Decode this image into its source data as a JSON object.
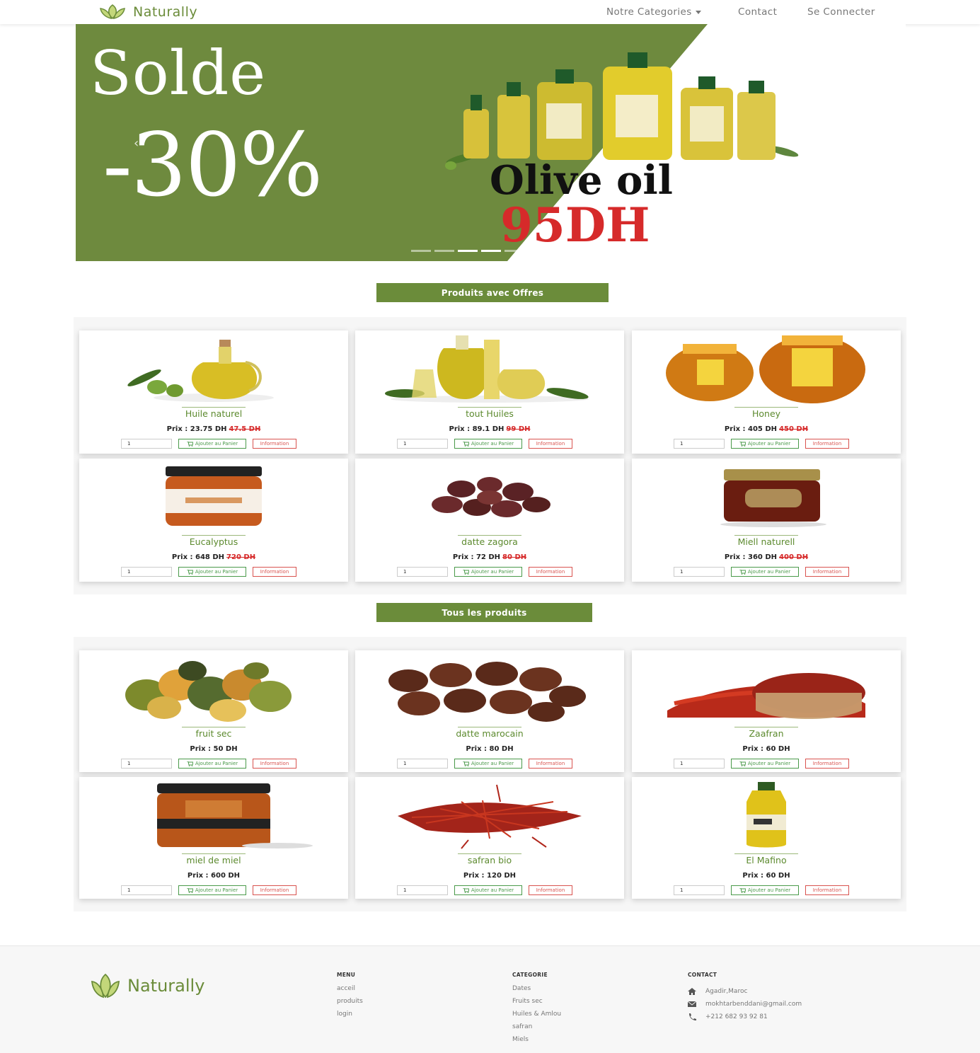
{
  "nav": {
    "brand": "Naturally",
    "categories": "Notre Categories",
    "contact": "Contact",
    "login": "Se Connecter"
  },
  "hero": {
    "line1": "Solde",
    "line2": "-30%",
    "product": "Olive oil",
    "price": "95DH",
    "prev": "‹",
    "active_slide": 3,
    "slide_count": 5
  },
  "colors": {
    "accent": "#6b8c3a",
    "danger": "#d62a2a"
  },
  "offers": {
    "title": "Produits avec Offres",
    "products": [
      {
        "name": "Huile naturel",
        "price": "Prix : 23.75 DH",
        "old": "47.5 DH",
        "qty": "1",
        "cart": "Ajouter au Panier",
        "info": "Information",
        "image": "olive-oil-jug"
      },
      {
        "name": "tout Huiles",
        "price": "Prix : 89.1 DH",
        "old": "99 DH",
        "qty": "1",
        "cart": "Ajouter au Panier",
        "info": "Information",
        "image": "oil-bottles"
      },
      {
        "name": "Honey",
        "price": "Prix : 405 DH",
        "old": "450 DH",
        "qty": "1",
        "cart": "Ajouter au Panier",
        "info": "Information",
        "image": "honey-jars"
      },
      {
        "name": "Eucalyptus",
        "price": "Prix : 648 DH",
        "old": "720 DH",
        "qty": "1",
        "cart": "Ajouter au Panier",
        "info": "Information",
        "image": "eucalyptus-jar"
      },
      {
        "name": "datte zagora",
        "price": "Prix : 72 DH",
        "old": "80 DH",
        "qty": "1",
        "cart": "Ajouter au Panier",
        "info": "Information",
        "image": "dates-small"
      },
      {
        "name": "Miell naturell",
        "price": "Prix : 360 DH",
        "old": "400 DH",
        "qty": "1",
        "cart": "Ajouter au Panier",
        "info": "Information",
        "image": "honey-dark-jar"
      }
    ]
  },
  "all": {
    "title": "Tous les produits",
    "products": [
      {
        "name": "fruit sec",
        "price": "Prix : 50 DH",
        "qty": "1",
        "cart": "Ajouter au Panier",
        "info": "Information",
        "image": "dried-fruit"
      },
      {
        "name": "datte marocain",
        "price": "Prix : 80 DH",
        "qty": "1",
        "cart": "Ajouter au Panier",
        "info": "Information",
        "image": "dates-large"
      },
      {
        "name": "Zaafran",
        "price": "Prix : 60 DH",
        "qty": "1",
        "cart": "Ajouter au Panier",
        "info": "Information",
        "image": "saffron-bowl"
      },
      {
        "name": "miel de miel",
        "price": "Prix : 600 DH",
        "qty": "1",
        "cart": "Ajouter au Panier",
        "info": "Information",
        "image": "miel-jar"
      },
      {
        "name": "safran bio",
        "price": "Prix : 120 DH",
        "qty": "1",
        "cart": "Ajouter au Panier",
        "info": "Information",
        "image": "saffron-threads"
      },
      {
        "name": "El Mafino",
        "price": "Prix : 60 DH",
        "qty": "1",
        "cart": "Ajouter au Panier",
        "info": "Information",
        "image": "oil-bottle"
      }
    ]
  },
  "footer": {
    "brand": "Naturally",
    "menu": {
      "title": "MENU",
      "items": [
        "acceil",
        "produits",
        "login"
      ]
    },
    "categorie": {
      "title": "CATEGORIE",
      "items": [
        "Dates",
        "Fruits sec",
        "Huiles & Amlou",
        "safran",
        "Miels"
      ]
    },
    "contact": {
      "title": "CONTACT",
      "address": "Agadir,Maroc",
      "email": "mokhtarbenddani@gmail.com",
      "phone": "+212 682 93 92 81"
    }
  }
}
